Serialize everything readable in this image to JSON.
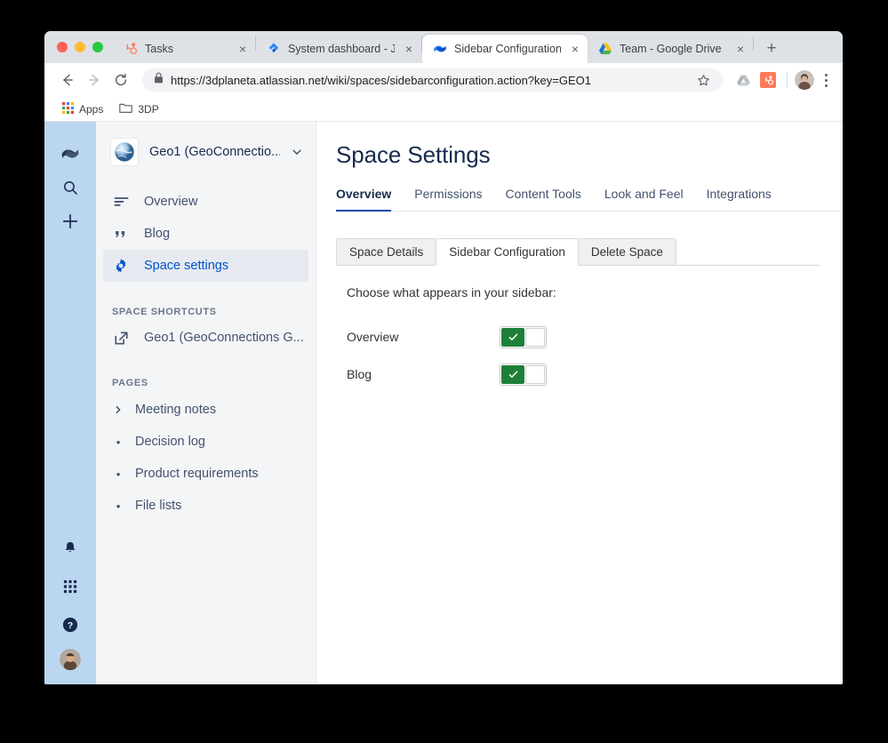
{
  "browser": {
    "traffic_lights": [
      "close",
      "minimize",
      "zoom"
    ],
    "tabs": [
      {
        "title": "Tasks",
        "favicon": "hubspot-icon",
        "active": false,
        "close_label": "×"
      },
      {
        "title": "System dashboard - Jira",
        "favicon": "jira-icon",
        "active": false,
        "close_label": "×"
      },
      {
        "title": "Sidebar Configuration - C",
        "favicon": "confluence-icon",
        "active": true,
        "close_label": "×"
      },
      {
        "title": "Team - Google Drive",
        "favicon": "google-drive-icon",
        "active": false,
        "close_label": "×"
      }
    ],
    "new_tab_label": "+",
    "nav": {
      "back": "←",
      "forward": "→",
      "reload": "⟳"
    },
    "omnibox": {
      "lock_icon": "lock-icon",
      "url_scheme": "https://",
      "url_host": "3dplaneta.atlassian.net",
      "url_path": "/wiki/spaces/sidebarconfiguration.action?key=GEO1",
      "url_full": "https://3dplaneta.atlassian.net/wiki/spaces/sidebarconfiguration.action?key=GEO1"
    },
    "toolbar_icons": [
      "star-icon",
      "drive-extension-icon",
      "hubspot-extension-icon",
      "profile-avatar",
      "kebab-menu-icon"
    ],
    "bookmarks": [
      {
        "label": "Apps",
        "icon": "apps-grid-icon"
      },
      {
        "label": "3DP",
        "icon": "folder-icon"
      }
    ]
  },
  "rail": {
    "top_icons": [
      "confluence-logo-icon",
      "search-icon",
      "create-icon"
    ],
    "bottom_icons": [
      "notifications-bell-icon",
      "app-switcher-grid-icon",
      "help-question-icon",
      "user-avatar"
    ]
  },
  "sidebar": {
    "space_name": "Geo1 (GeoConnectio...",
    "space_logo": "globe-space-icon",
    "chevron": "chevron-down-icon",
    "items": [
      {
        "label": "Overview",
        "icon": "overview-lines-icon",
        "active": false
      },
      {
        "label": "Blog",
        "icon": "blog-quote-icon",
        "active": false
      },
      {
        "label": "Space settings",
        "icon": "gear-icon",
        "active": true
      }
    ],
    "shortcuts_label": "SPACE SHORTCUTS",
    "shortcuts": [
      {
        "label": "Geo1 (GeoConnections G...",
        "icon": "external-link-icon"
      }
    ],
    "pages_label": "PAGES",
    "pages": [
      {
        "label": "Meeting notes",
        "marker": "chevron-right-icon"
      },
      {
        "label": "Decision log",
        "marker": "bullet-icon"
      },
      {
        "label": "Product requirements",
        "marker": "bullet-icon"
      },
      {
        "label": "File lists",
        "marker": "bullet-icon"
      }
    ]
  },
  "main": {
    "title": "Space Settings",
    "tabs": [
      {
        "label": "Overview",
        "active": true
      },
      {
        "label": "Permissions",
        "active": false
      },
      {
        "label": "Content Tools",
        "active": false
      },
      {
        "label": "Look and Feel",
        "active": false
      },
      {
        "label": "Integrations",
        "active": false
      }
    ],
    "subtabs": [
      {
        "label": "Space Details",
        "active": false
      },
      {
        "label": "Sidebar Configuration",
        "active": true
      },
      {
        "label": "Delete Space",
        "active": false
      }
    ],
    "intro": "Choose what appears in your sidebar:",
    "options": [
      {
        "label": "Overview",
        "enabled": true,
        "check": "✓"
      },
      {
        "label": "Blog",
        "enabled": true,
        "check": "✓"
      }
    ]
  },
  "colors": {
    "rail_bg": "#bbd7f0",
    "sidebar_bg": "#f4f5f7",
    "accent_blue": "#0052cc",
    "tab_underline": "#0747a6",
    "toggle_green": "#1e8037",
    "tabstrip_bg": "#dee1e6"
  }
}
